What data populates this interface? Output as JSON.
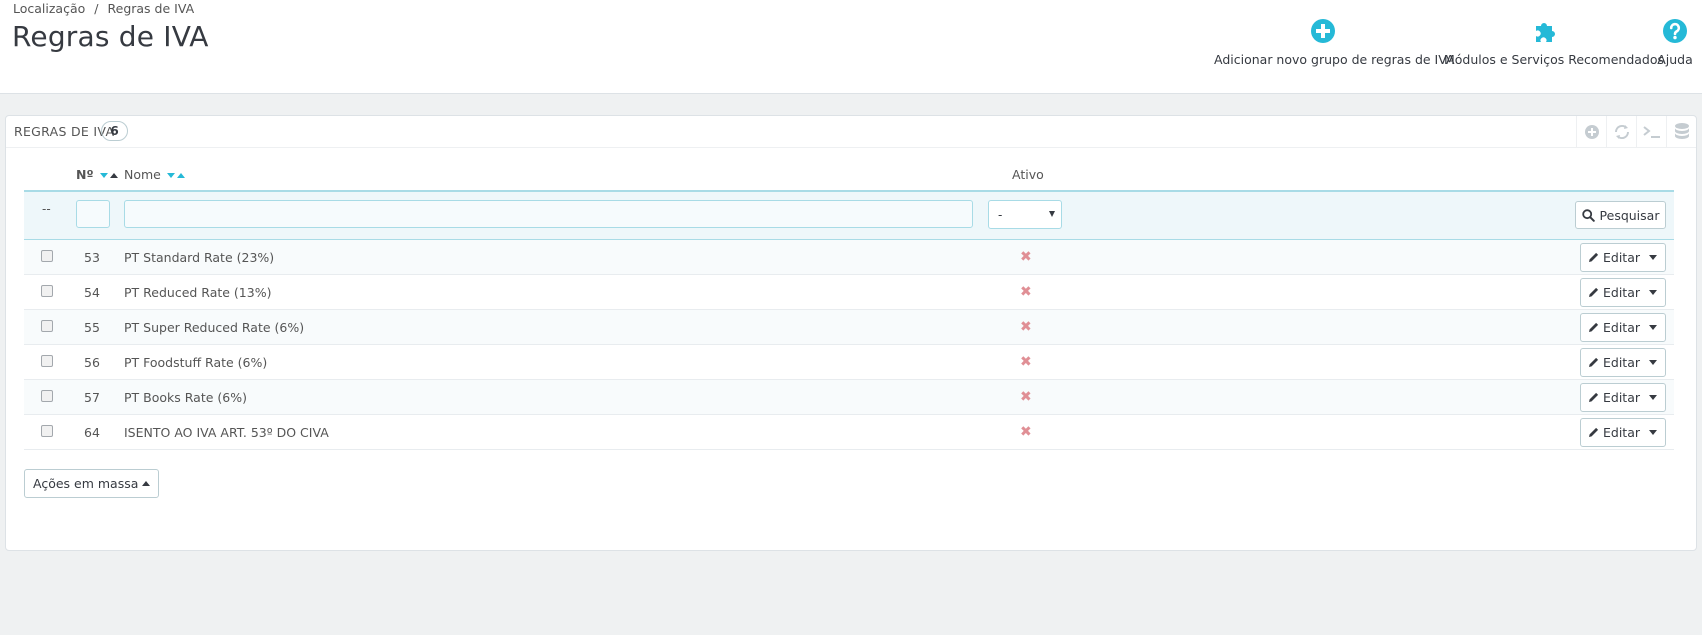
{
  "breadcrumb": {
    "parent": "Localização",
    "separator": "/",
    "current": "Regras de IVA"
  },
  "page_title": "Regras de IVA",
  "toolbar": {
    "add_label": "Adicionar novo grupo de regras de IVA",
    "add_icon": "plus-circle-icon",
    "modules_label": "Módulos e Serviços Recomendados",
    "modules_icon": "puzzle-icon",
    "help_label": "Ajuda",
    "help_icon": "question-circle-icon"
  },
  "panel": {
    "title": "REGRAS DE IVA",
    "count": "6",
    "tools": [
      "add-icon",
      "refresh-icon",
      "terminal-icon",
      "database-icon"
    ]
  },
  "table": {
    "headers": {
      "id": "Nº",
      "name": "Nome",
      "active": "Ativo"
    },
    "filter": {
      "dash": "--",
      "id_value": "",
      "name_value": "",
      "active_value": "-",
      "search_label": "Pesquisar"
    },
    "rows": [
      {
        "id": "53",
        "name": "PT Standard Rate (23%)",
        "active": "✖"
      },
      {
        "id": "54",
        "name": "PT Reduced Rate (13%)",
        "active": "✖"
      },
      {
        "id": "55",
        "name": "PT Super Reduced Rate (6%)",
        "active": "✖"
      },
      {
        "id": "56",
        "name": "PT Foodstuff Rate (6%)",
        "active": "✖"
      },
      {
        "id": "57",
        "name": "PT Books Rate (6%)",
        "active": "✖"
      },
      {
        "id": "64",
        "name": "ISENTO AO IVA ART. 53º DO CIVA",
        "active": "✖"
      }
    ],
    "edit_label": "Editar"
  },
  "bulk_actions_label": "Ações em massa",
  "colors": {
    "accent": "#25b9d7",
    "inactive": "#e08f95",
    "text": "#363a41"
  }
}
